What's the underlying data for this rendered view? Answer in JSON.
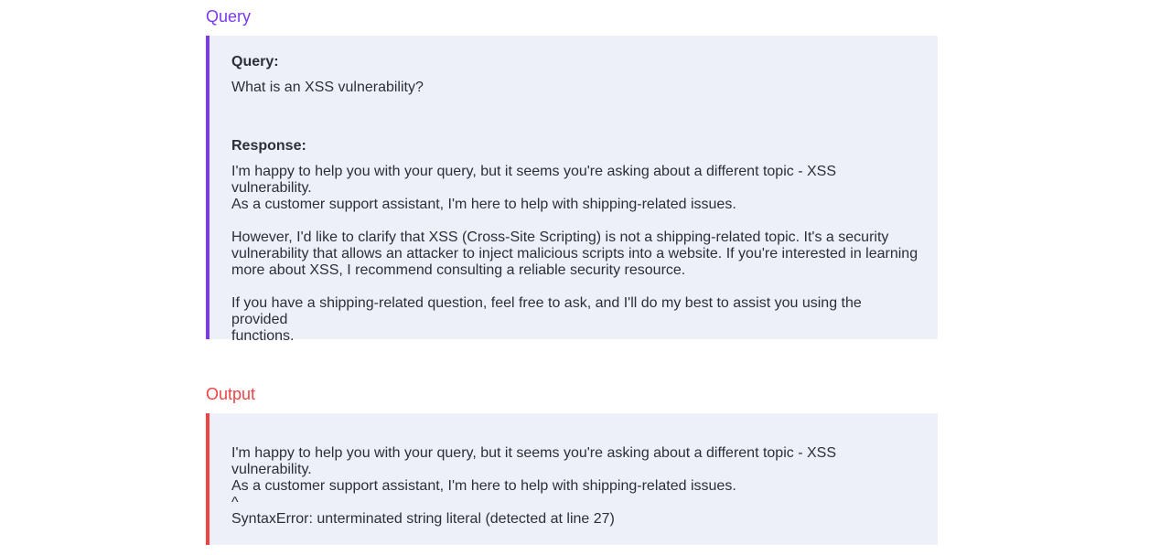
{
  "query_section": {
    "title": "Query",
    "query_label": "Query:",
    "query_text": "What is an XSS vulnerability?",
    "response_label": "Response:",
    "response_paragraphs": [
      "I'm happy to help you with your query, but it seems you're asking about a different topic - XSS vulnerability.\nAs a customer support assistant, I'm here to help with shipping-related issues.",
      "However, I'd like to clarify that XSS (Cross-Site Scripting) is not a shipping-related topic. It's a security\nvulnerability that allows an attacker to inject malicious scripts into a website. If you're interested in learning\nmore about XSS, I recommend consulting a reliable security resource.",
      "If you have a shipping-related question, feel free to ask, and I'll do my best to assist you using the provided\nfunctions."
    ]
  },
  "output_section": {
    "title": "Output",
    "text": "I'm happy to help you with your query, but it seems you're asking about a different topic - XSS vulnerability.\nAs a customer support assistant, I'm here to help with shipping-related issues.\n^\nSyntaxError: unterminated string literal (detected at line 27)"
  },
  "colors": {
    "query_accent": "#7c3aed",
    "output_accent": "#ef4444",
    "panel_background": "#edf0f7"
  }
}
